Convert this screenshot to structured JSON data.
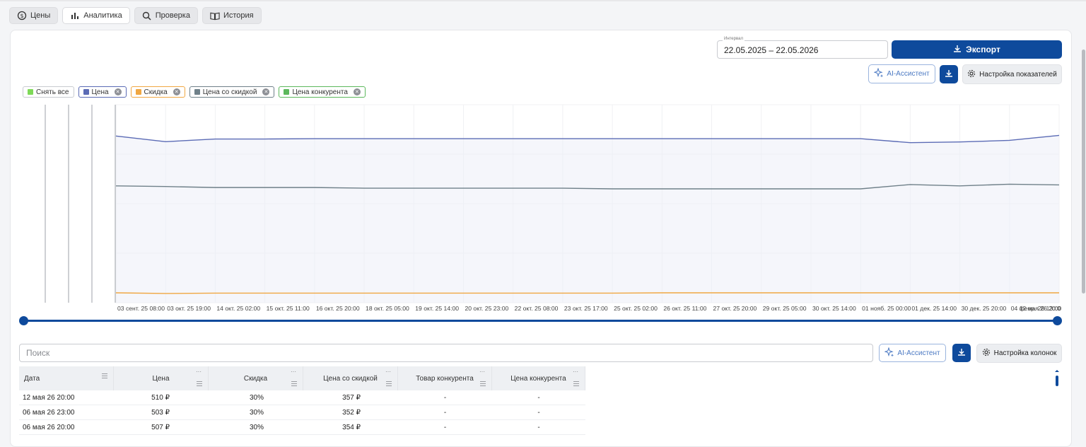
{
  "tabs": [
    {
      "label": "Цены",
      "icon": "price-refresh-icon"
    },
    {
      "label": "Аналитика",
      "icon": "bar-chart-icon",
      "active": true
    },
    {
      "label": "Проверка",
      "icon": "search-icon"
    },
    {
      "label": "История",
      "icon": "book-icon"
    }
  ],
  "toolbar": {
    "interval_label": "Интервал",
    "interval_value": "22.05.2025 – 22.05.2026",
    "export_label": "Экспорт",
    "ai_label": "AI-Ассистент",
    "settings_label": "Настройка показателей"
  },
  "legend": [
    {
      "label": "Снять все",
      "color": "#7ed957",
      "closable": false
    },
    {
      "label": "Цена",
      "color": "#5b6bb5",
      "closable": true
    },
    {
      "label": "Скидка",
      "color": "#f0a742",
      "closable": true
    },
    {
      "label": "Цена со скидкой",
      "color": "#6f8089",
      "closable": true
    },
    {
      "label": "Цена конкурента",
      "color": "#5cb85c",
      "closable": true
    }
  ],
  "chart_data": {
    "type": "line",
    "x": [
      "03 сент. 25 08:00",
      "03 окт. 25 19:00",
      "14 окт. 25 02:00",
      "15 окт. 25 11:00",
      "16 окт. 25 20:00",
      "18 окт. 25 05:00",
      "19 окт. 25 14:00",
      "20 окт. 25 23:00",
      "22 окт. 25 08:00",
      "23 окт. 25 17:00",
      "25 окт. 25 02:00",
      "26 окт. 25 11:00",
      "27 окт. 25 20:00",
      "29 окт. 25 05:00",
      "30 окт. 25 14:00",
      "01 нояб. 25 00:00",
      "01 дек. 25 14:00",
      "30 дек. 25 20:00",
      "04 февр. 26 13:00",
      "12 мая 26 20:0"
    ],
    "series": [
      {
        "name": "Цена",
        "color": "#5b6bb5",
        "values": [
          505,
          488,
          496,
          496,
          497,
          497,
          497,
          497,
          497,
          497,
          497,
          497,
          497,
          497,
          497,
          497,
          485,
          487,
          492,
          507
        ]
      },
      {
        "name": "Цена со скидкой",
        "color": "#6f8089",
        "values": [
          354,
          352,
          349,
          349,
          349,
          347,
          347,
          347,
          347,
          347,
          345,
          345,
          345,
          345,
          345,
          345,
          358,
          354,
          359,
          357
        ]
      },
      {
        "name": "Скидка",
        "color": "#f0a742",
        "values": [
          30,
          28,
          29,
          29,
          29,
          29,
          29,
          29,
          29,
          29,
          29,
          30,
          30,
          30,
          30,
          30,
          30,
          30,
          30,
          30
        ]
      }
    ],
    "grid": true,
    "legend": "top-left"
  },
  "search": {
    "placeholder": "Поиск"
  },
  "table_tools": {
    "ai_label": "AI-Ассистент",
    "columns_label": "Настройка колонок"
  },
  "table": {
    "columns": [
      "Дата",
      "Цена",
      "Скидка",
      "Цена со скидкой",
      "Товар конкурента",
      "Цена конкурента"
    ],
    "rows": [
      [
        "12 мая 26 20:00",
        "510 ₽",
        "30%",
        "357 ₽",
        "-",
        "-"
      ],
      [
        "06 мая 26 23:00",
        "503 ₽",
        "30%",
        "352 ₽",
        "-",
        "-"
      ],
      [
        "06 мая 26 20:00",
        "507 ₽",
        "30%",
        "354 ₽",
        "-",
        "-"
      ]
    ]
  }
}
